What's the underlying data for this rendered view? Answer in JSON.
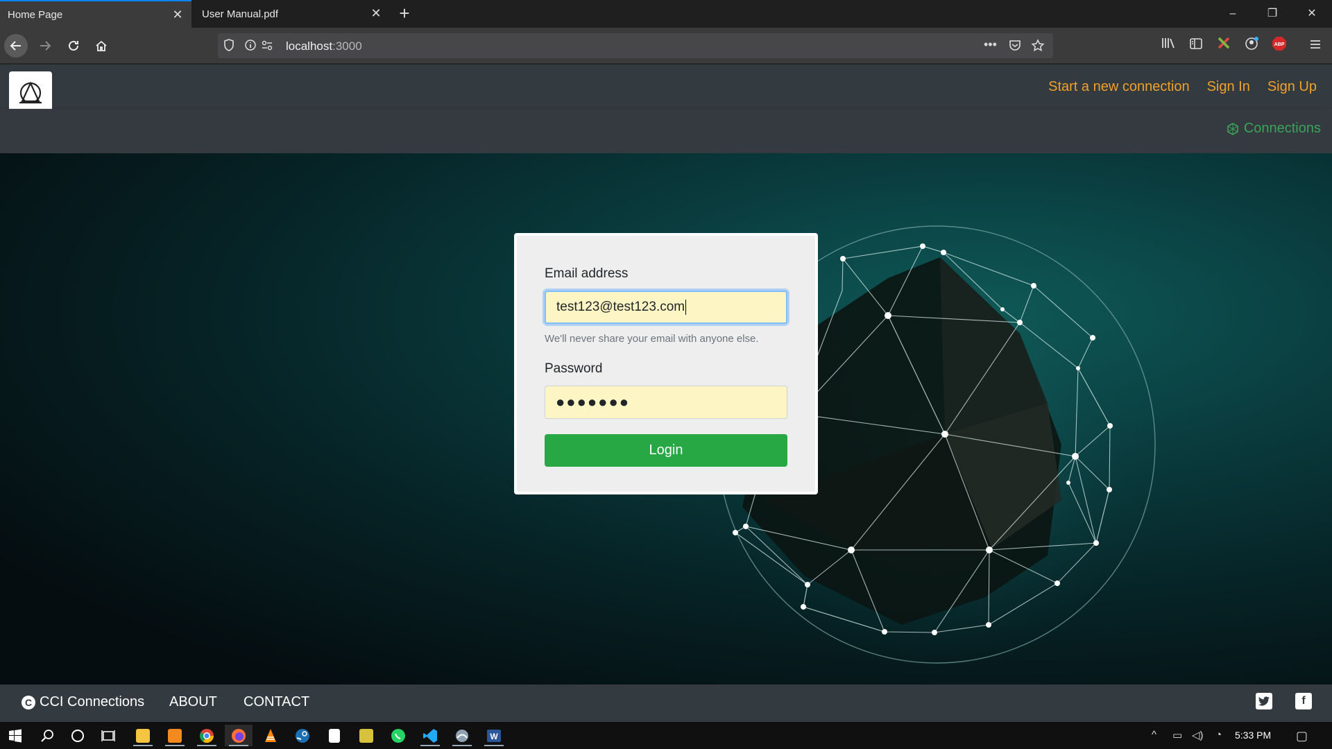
{
  "browser": {
    "tabs": [
      {
        "label": "Home Page",
        "active": true
      },
      {
        "label": "User Manual.pdf",
        "active": false
      }
    ],
    "url_host": "localhost",
    "url_port": ":3000"
  },
  "site": {
    "header_links": [
      "Start a new connection",
      "Sign In",
      "Sign Up"
    ],
    "connections_link": "Connections"
  },
  "login_form": {
    "email_label": "Email address",
    "email_value": "test123@test123.com",
    "email_help": "We'll never share your email with anyone else.",
    "password_label": "Password",
    "password_masked": "●●●●●●●",
    "login_button": "Login"
  },
  "footer": {
    "brand": "CCI Connections",
    "about": "ABOUT",
    "contact": "CONTACT"
  },
  "taskbar": {
    "clock": "5:33 PM",
    "apps": [
      "file-explorer-icon",
      "sublime-icon",
      "chrome-icon",
      "firefox-icon",
      "vlc-icon",
      "steam-icon",
      "notepad-icon",
      "norton-icon",
      "whatsapp-icon",
      "vscode-icon",
      "app-icon",
      "word-icon"
    ]
  },
  "colors": {
    "accent_orange": "#f0a12a",
    "accent_green": "#28a745",
    "header_bg": "#333a40"
  }
}
